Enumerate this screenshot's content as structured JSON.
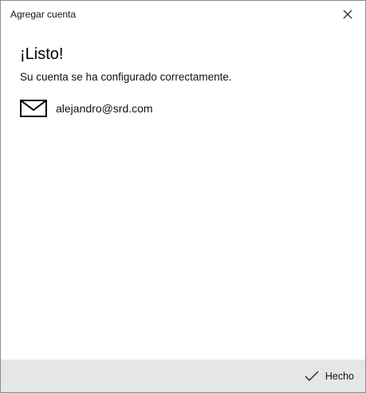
{
  "window": {
    "title": "Agregar cuenta",
    "close_icon": "close-icon"
  },
  "main": {
    "heading": "¡Listo!",
    "message": "Su cuenta se ha configurado correctamente.",
    "account": {
      "icon": "mail-icon",
      "email": "alejandro@srd.com"
    }
  },
  "footer": {
    "done_label": "Hecho",
    "done_icon": "checkmark-icon",
    "background": "#e6e6e6"
  }
}
